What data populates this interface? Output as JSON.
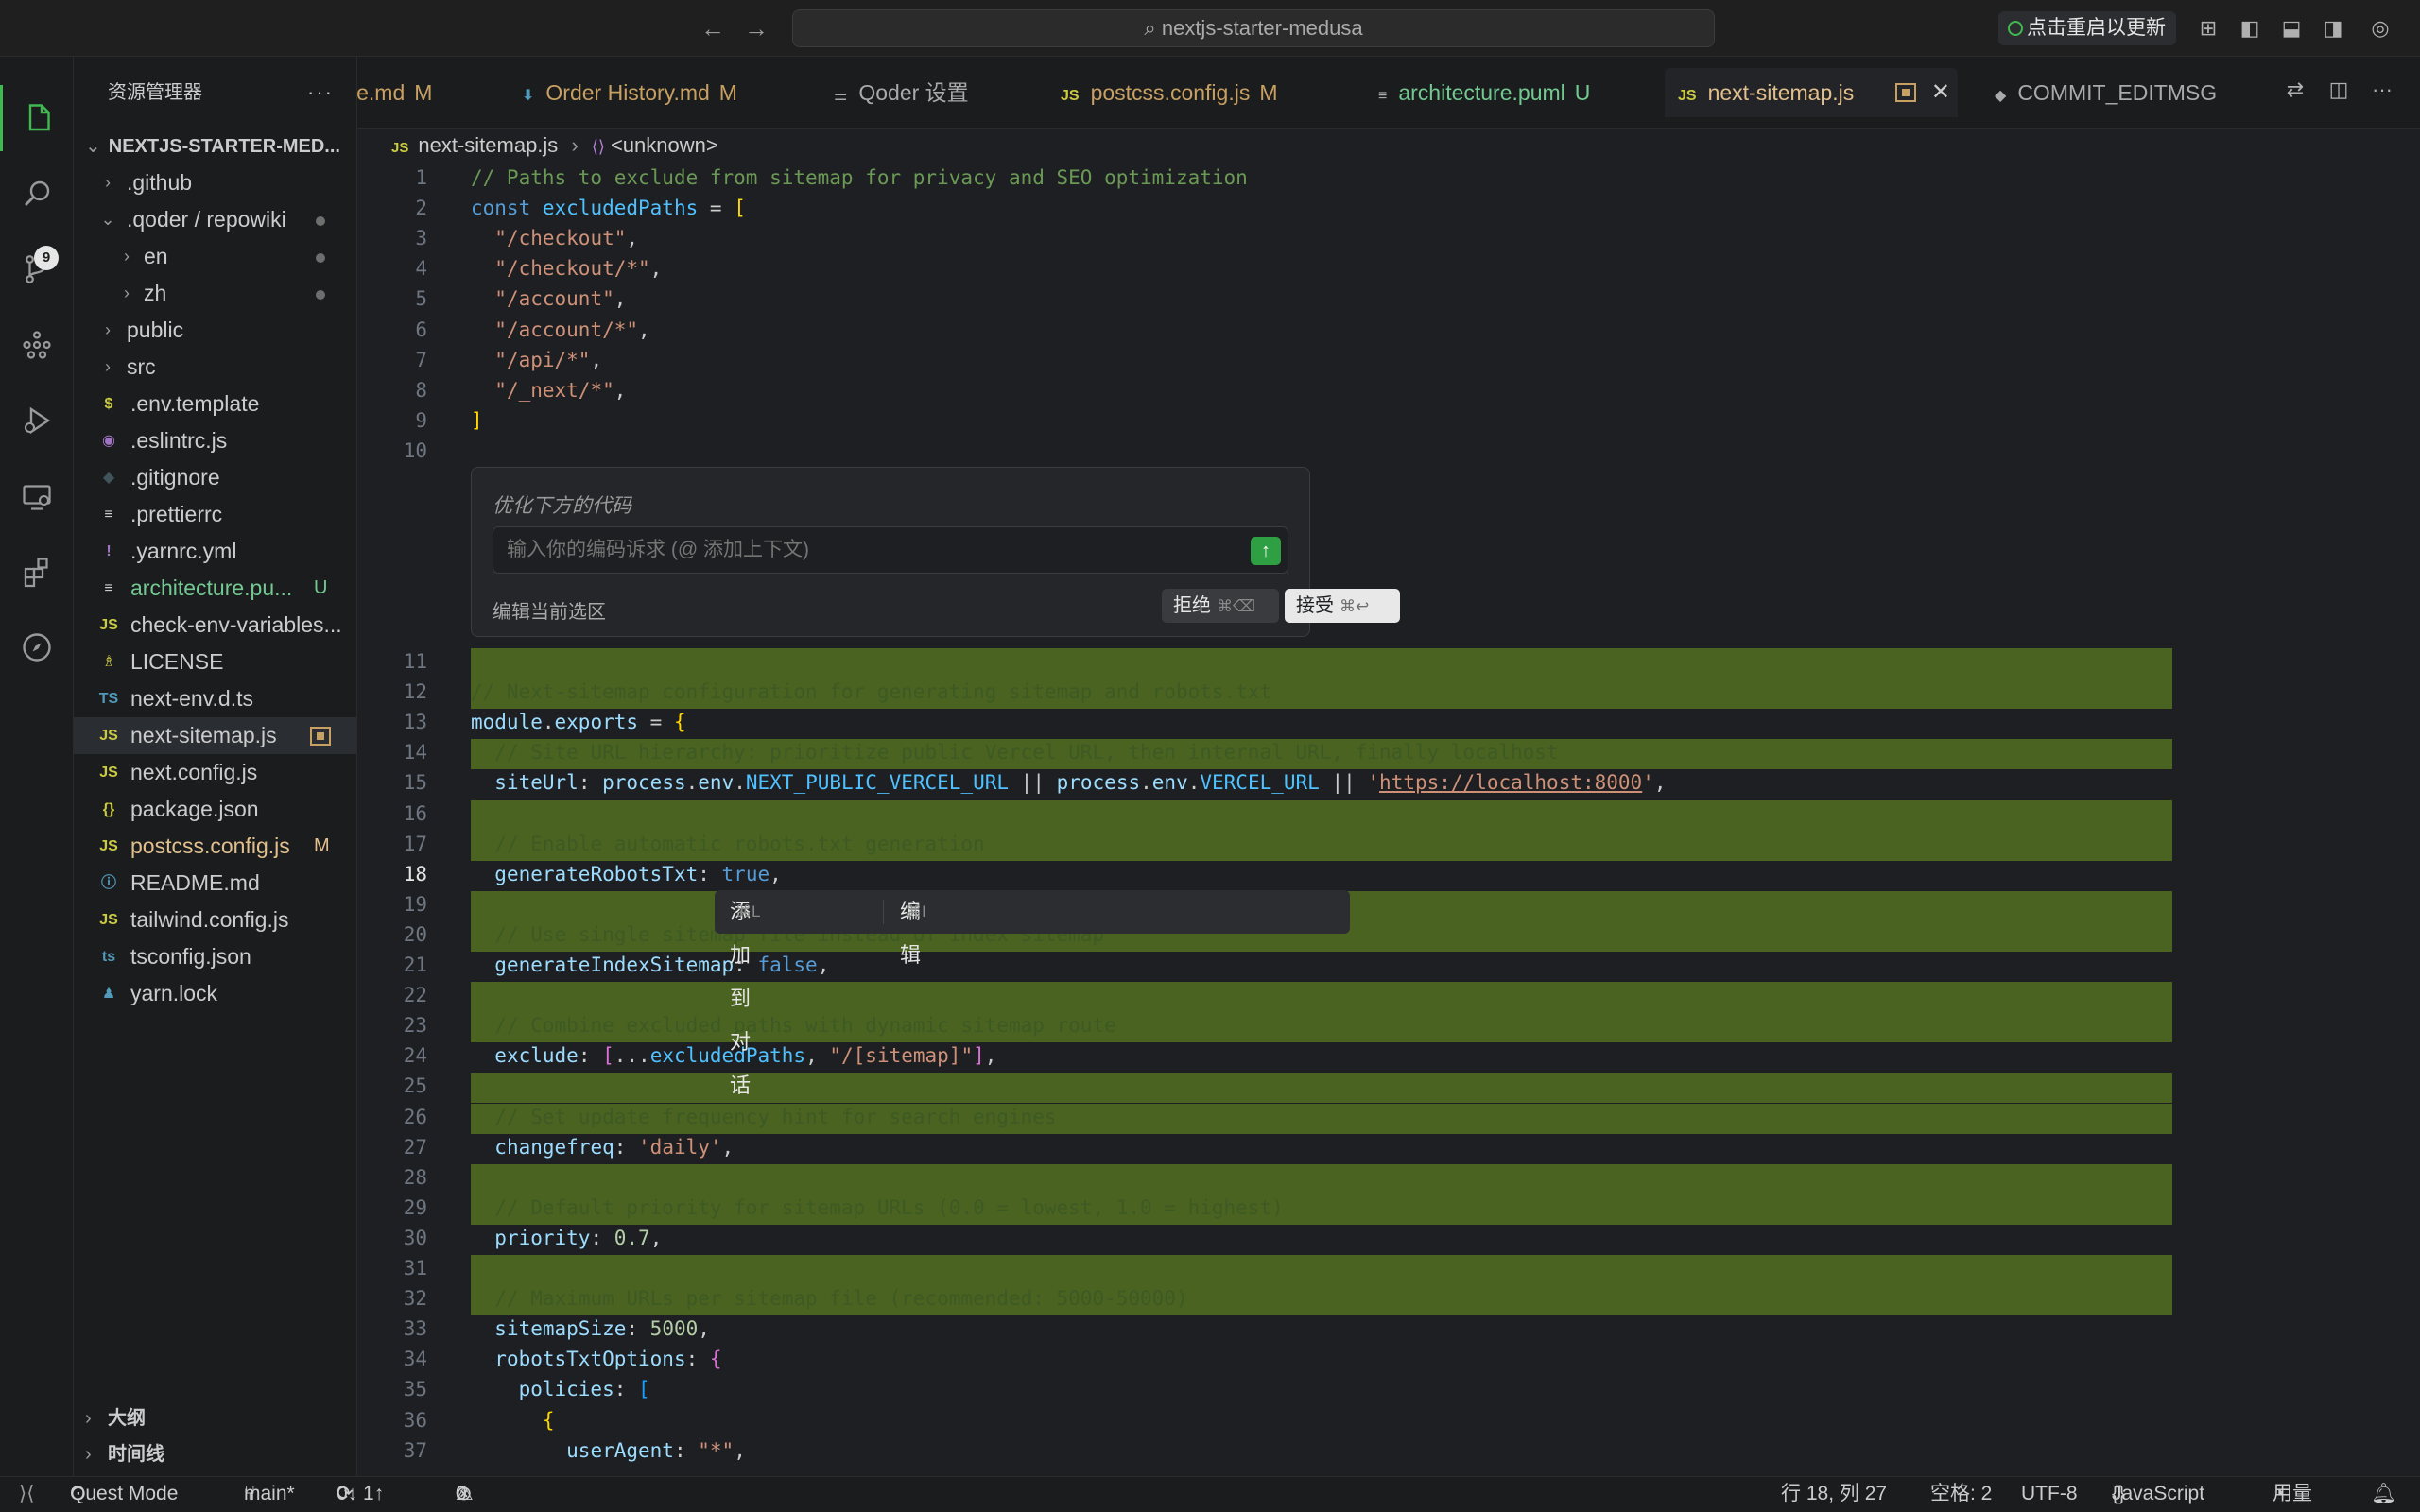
{
  "titlebar": {
    "search_text": "nextjs-starter-medusa",
    "update_label": "点击重启以更新"
  },
  "activity": {
    "scm_badge": "9"
  },
  "sidebar": {
    "title": "资源管理器",
    "more": "···",
    "project": "NEXTJS-STARTER-MED...",
    "items": [
      {
        "label": ".github",
        "kind": "folder",
        "open": false,
        "depth": 1
      },
      {
        "label": ".qoder / repowiki",
        "kind": "folder",
        "open": true,
        "depth": 1,
        "dot": true
      },
      {
        "label": "en",
        "kind": "folder",
        "open": false,
        "depth": 2,
        "dot": true
      },
      {
        "label": "zh",
        "kind": "folder",
        "open": false,
        "depth": 2,
        "dot": true
      },
      {
        "label": "public",
        "kind": "folder",
        "open": false,
        "depth": 1
      },
      {
        "label": "src",
        "kind": "folder",
        "open": false,
        "depth": 1
      },
      {
        "label": ".env.template",
        "icon": "$",
        "icon_color": "#cbcb41"
      },
      {
        "label": ".eslintrc.js",
        "icon": "◉",
        "icon_color": "#a074c4"
      },
      {
        "label": ".gitignore",
        "icon": "◆",
        "icon_color": "#41535b"
      },
      {
        "label": ".prettierrc",
        "icon": "≡",
        "icon_color": "#cccccc"
      },
      {
        "label": ".yarnrc.yml",
        "icon": "!",
        "icon_color": "#a074c4"
      },
      {
        "label": "architecture.pu...",
        "icon": "≡",
        "icon_color": "#cccccc",
        "status": "U",
        "color": "green"
      },
      {
        "label": "check-env-variables...",
        "icon": "JS",
        "icon_color": "#cbcb41"
      },
      {
        "label": "LICENSE",
        "icon": "♗",
        "icon_color": "#cbcb41"
      },
      {
        "label": "next-env.d.ts",
        "icon": "TS",
        "icon_color": "#519aba"
      },
      {
        "label": "next-sitemap.js",
        "icon": "JS",
        "icon_color": "#cbcb41",
        "selected": true,
        "boxdot": true
      },
      {
        "label": "next.config.js",
        "icon": "JS",
        "icon_color": "#cbcb41"
      },
      {
        "label": "package.json",
        "icon": "{}",
        "icon_color": "#cbcb41"
      },
      {
        "label": "postcss.config.js",
        "icon": "JS",
        "icon_color": "#cbcb41",
        "status": "M",
        "color": "yellow"
      },
      {
        "label": "README.md",
        "icon": "ⓘ",
        "icon_color": "#519aba"
      },
      {
        "label": "tailwind.config.js",
        "icon": "JS",
        "icon_color": "#cbcb41"
      },
      {
        "label": "tsconfig.json",
        "icon": "ts",
        "icon_color": "#519aba"
      },
      {
        "label": "yarn.lock",
        "icon": "♟",
        "icon_color": "#519aba"
      }
    ],
    "outline": "大纲",
    "timeline": "时间线"
  },
  "tabs": [
    {
      "label": "le.md",
      "status": "M",
      "icon": ""
    },
    {
      "label": "Order History.md",
      "status": "M",
      "icon": "⬇"
    },
    {
      "label": "Qoder 设置",
      "status": "",
      "icon": "⚌"
    },
    {
      "label": "postcss.config.js",
      "status": "M",
      "icon": "JS"
    },
    {
      "label": "architecture.puml",
      "status": "U",
      "icon": "≡"
    },
    {
      "label": "next-sitemap.js",
      "status": "",
      "icon": "JS",
      "active": true
    },
    {
      "label": "COMMIT_EDITMSG",
      "status": "",
      "icon": "◆"
    }
  ],
  "breadcrumb": {
    "file": "next-sitemap.js",
    "symbol": "<unknown>"
  },
  "inline_chat": {
    "title": "优化下方的代码",
    "placeholder": "输入你的编码诉求 (@ 添加上下文)",
    "scope": "编辑当前选区",
    "reject": "拒绝",
    "reject_kbd": "⌘⌫",
    "accept": "接受",
    "accept_kbd": "⌘↩"
  },
  "selection_popup": {
    "add_to_chat": "添加到对话",
    "add_kbd": "⌘L",
    "edit": "编辑",
    "edit_kbd": "⌘I"
  },
  "code_lines": [
    {
      "n": "1",
      "html": "<span class='cm'>// Paths to exclude from sitemap for privacy and SEO optimization</span>"
    },
    {
      "n": "2",
      "html": "<span class='kw'>const</span> <span class='cst'>excludedPaths</span> = <span class='br'>[</span>"
    },
    {
      "n": "3",
      "html": "  <span class='str'>\"/checkout\"</span>,"
    },
    {
      "n": "4",
      "html": "  <span class='str'>\"/checkout/*\"</span>,"
    },
    {
      "n": "5",
      "html": "  <span class='str'>\"/account\"</span>,"
    },
    {
      "n": "6",
      "html": "  <span class='str'>\"/account/*\"</span>,"
    },
    {
      "n": "7",
      "html": "  <span class='str'>\"/api/*\"</span>,"
    },
    {
      "n": "8",
      "html": "  <span class='str'>\"/_next/*\"</span>,"
    },
    {
      "n": "9",
      "html": "<span class='br'>]</span>"
    },
    {
      "n": "10",
      "html": ""
    },
    {
      "n": "11",
      "html": "",
      "hl": true
    },
    {
      "n": "12",
      "html": "<span class='cm'>// Next-sitemap configuration for generating sitemap and robots.txt</span>",
      "hl": true
    },
    {
      "n": "13",
      "html": "<span class='prop'>module</span>.<span class='prop'>exports</span> = <span class='br'>{</span>"
    },
    {
      "n": "14",
      "html": "  <span class='cm'>// Site URL hierarchy: prioritize public Vercel URL, then internal URL, finally localhost</span>",
      "hl": true
    },
    {
      "n": "15",
      "html": "  <span class='prop'>siteUrl</span>: <span class='prop'>process</span>.<span class='prop'>env</span>.<span class='cst'>NEXT_PUBLIC_VERCEL_URL</span> || <span class='prop'>process</span>.<span class='prop'>env</span>.<span class='cst'>VERCEL_URL</span> || <span class='str'>'</span><span class='url'>https://localhost:8000</span><span class='str'>'</span>,"
    },
    {
      "n": "16",
      "html": "",
      "hl": true
    },
    {
      "n": "17",
      "html": "  <span class='cm'>// Enable automatic robots.txt generation</span>",
      "hl": true
    },
    {
      "n": "18",
      "html": "  <span class='prop'>generateRobotsTxt</span>: <span class='kw'>true</span>,",
      "cur": true
    },
    {
      "n": "19",
      "html": "",
      "hl": true
    },
    {
      "n": "20",
      "html": "  <span class='cm'>// Use single sitemap file instead of index sitemap</span>",
      "hl": true
    },
    {
      "n": "21",
      "html": "  <span class='prop'>generateIndexSitemap</span>: <span class='kw'>false</span>,"
    },
    {
      "n": "22",
      "html": "",
      "hl": true
    },
    {
      "n": "23",
      "html": "  <span class='cm'>// Combine excluded paths with dynamic sitemap route</span>",
      "hl": true
    },
    {
      "n": "24",
      "html": "  <span class='prop'>exclude</span>: <span class='br2'>[</span>...<span class='cst'>excludedPaths</span>, <span class='str'>\"/[sitemap]\"</span><span class='br2'>]</span>,"
    },
    {
      "n": "25",
      "html": "",
      "hl": true
    },
    {
      "n": "26",
      "html": "  <span class='cm'>// Set update frequency hint for search engines</span>",
      "hl": true
    },
    {
      "n": "27",
      "html": "  <span class='prop'>changefreq</span>: <span class='str'>'daily'</span>,"
    },
    {
      "n": "28",
      "html": "",
      "hl": true
    },
    {
      "n": "29",
      "html": "  <span class='cm'>// Default priority for sitemap URLs (0.0 = lowest, 1.0 = highest)</span>",
      "hl": true
    },
    {
      "n": "30",
      "html": "  <span class='prop'>priority</span>: <span class='num'>0.7</span>,"
    },
    {
      "n": "31",
      "html": "",
      "hl": true
    },
    {
      "n": "32",
      "html": "  <span class='cm'>// Maximum URLs per sitemap file (recommended: 5000-50000)</span>",
      "hl": true
    },
    {
      "n": "33",
      "html": "  <span class='prop'>sitemapSize</span>: <span class='num'>5000</span>,"
    },
    {
      "n": "34",
      "html": "  <span class='prop'>robotsTxtOptions</span>: <span class='br2'>{</span>"
    },
    {
      "n": "35",
      "html": "    <span class='prop'>policies</span>: <span class='br3'>[</span>"
    },
    {
      "n": "36",
      "html": "      <span class='br'>{</span>"
    },
    {
      "n": "37",
      "html": "        <span class='prop'>userAgent</span>: <span class='str'>\"*\"</span>,"
    }
  ],
  "statusbar": {
    "mode": "Quest Mode",
    "branch": "main*",
    "sync": "0↓ 1↑",
    "problems": "0",
    "warnings": "0",
    "position": "行 18, 列 27",
    "spaces": "空格: 2",
    "encoding": "UTF-8",
    "language": "JavaScript",
    "usage": "用量"
  }
}
